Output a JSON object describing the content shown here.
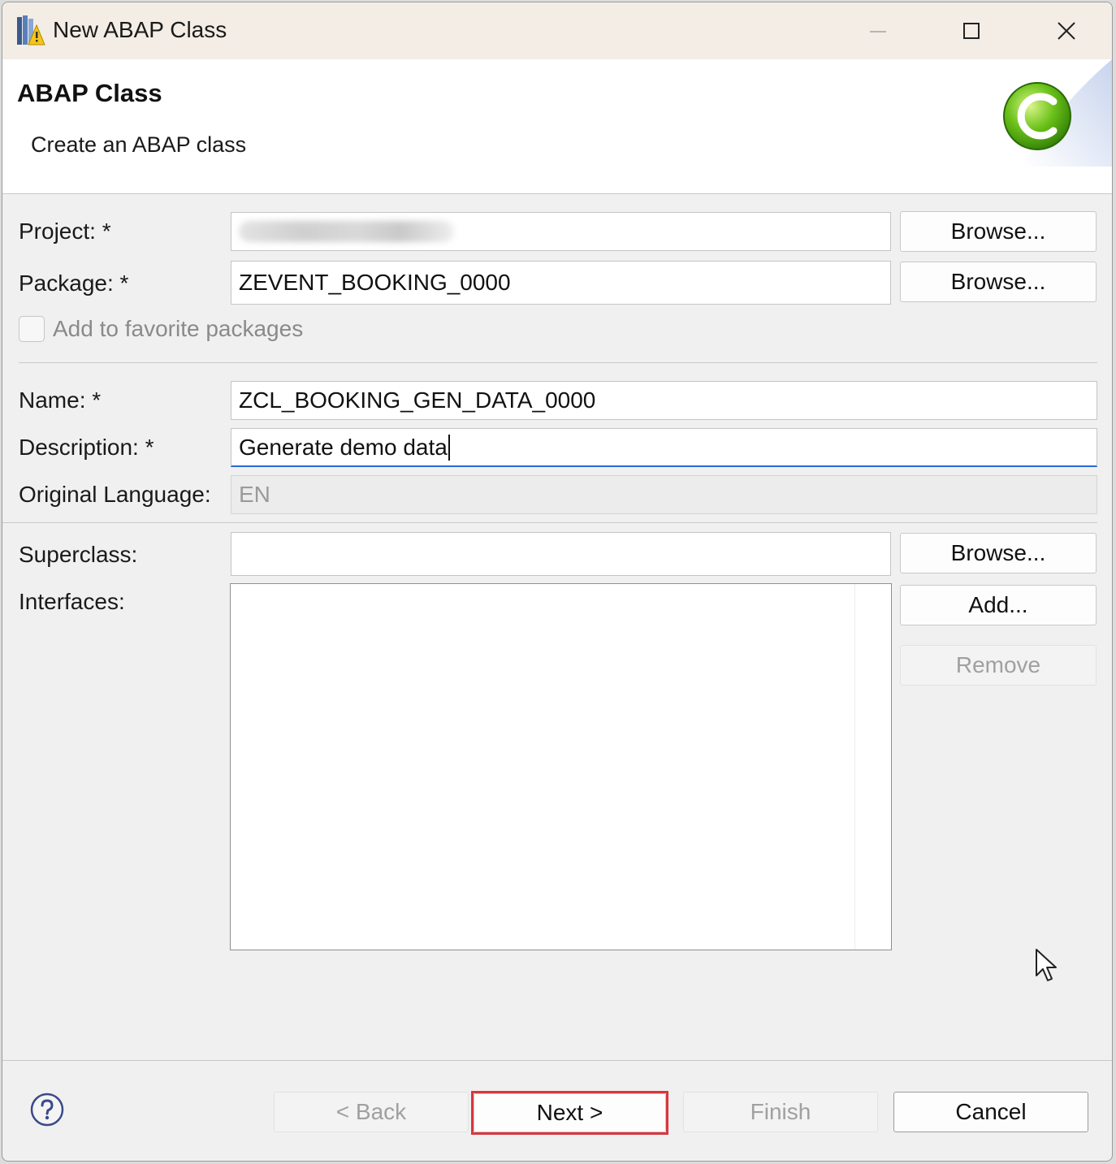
{
  "window": {
    "title": "New ABAP Class"
  },
  "header": {
    "title": "ABAP Class",
    "subtitle": "Create an ABAP class",
    "icon": "class-c-icon"
  },
  "form": {
    "project": {
      "label": "Project: *",
      "value": "",
      "browse_label": "Browse..."
    },
    "package": {
      "label": "Package: *",
      "value": "ZEVENT_BOOKING_0000",
      "browse_label": "Browse..."
    },
    "favorite": {
      "label": "Add to favorite packages",
      "checked": false
    },
    "name": {
      "label": "Name: *",
      "value": "ZCL_BOOKING_GEN_DATA_0000"
    },
    "description": {
      "label": "Description: *",
      "value": "Generate demo data"
    },
    "original_language": {
      "label": "Original Language:",
      "value": "EN"
    },
    "superclass": {
      "label": "Superclass:",
      "value": "",
      "browse_label": "Browse..."
    },
    "interfaces": {
      "label": "Interfaces:",
      "items": [],
      "add_label": "Add...",
      "remove_label": "Remove"
    }
  },
  "footer": {
    "back_label": "< Back",
    "next_label": "Next >",
    "finish_label": "Finish",
    "cancel_label": "Cancel",
    "highlight_color": "#d9363e"
  }
}
